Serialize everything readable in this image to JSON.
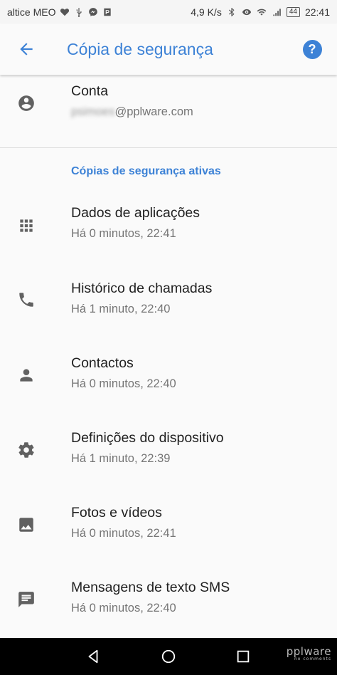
{
  "status_bar": {
    "carrier": "altice MEO",
    "speed": "4,9 K/s",
    "battery": "44",
    "time": "22:41"
  },
  "app_bar": {
    "title": "Cópia de segurança",
    "help_label": "?"
  },
  "account": {
    "title": "Conta",
    "email_user": "psimoes",
    "email_domain": "@pplware.com"
  },
  "section": {
    "header": "Cópias de segurança ativas"
  },
  "items": [
    {
      "icon": "apps-grid-icon",
      "title": "Dados de aplicações",
      "subtitle": "Há 0 minutos, 22:41"
    },
    {
      "icon": "phone-icon",
      "title": "Histórico de chamadas",
      "subtitle": "Há 1 minuto, 22:40"
    },
    {
      "icon": "person-icon",
      "title": "Contactos",
      "subtitle": "Há 0 minutos, 22:40"
    },
    {
      "icon": "gear-icon",
      "title": "Definições do dispositivo",
      "subtitle": "Há 1 minuto, 22:39"
    },
    {
      "icon": "image-icon",
      "title": "Fotos e vídeos",
      "subtitle": "Há 0 minutos, 22:41"
    },
    {
      "icon": "message-icon",
      "title": "Mensagens de texto SMS",
      "subtitle": "Há 0 minutos, 22:40"
    }
  ],
  "watermark": {
    "brand": "pplware",
    "tagline": "no comments"
  },
  "colors": {
    "accent": "#3d82d6",
    "icon": "#616161",
    "nav_bar": "#000000"
  }
}
